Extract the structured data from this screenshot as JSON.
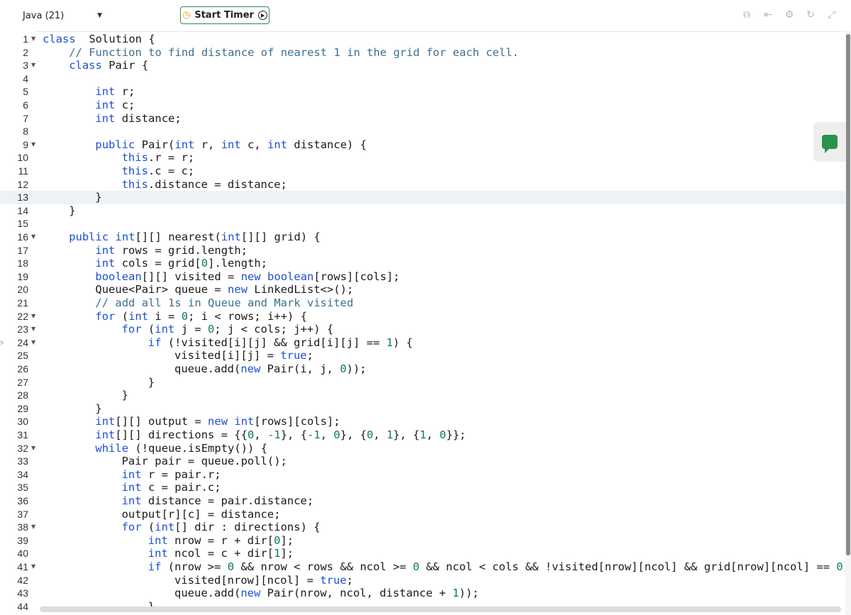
{
  "toolbar": {
    "language": "Java (21)",
    "timer_label": "Start Timer"
  },
  "editor": {
    "current_line": 13,
    "lines": [
      {
        "n": "1",
        "fold": true,
        "indent": 0,
        "segs": [
          [
            "kw",
            "class"
          ],
          [
            "",
            "  Solution {"
          ]
        ]
      },
      {
        "n": "2",
        "fold": false,
        "indent": 4,
        "segs": [
          [
            "cm",
            "// Function to find distance of nearest 1 in the grid for each cell."
          ]
        ]
      },
      {
        "n": "3",
        "fold": true,
        "indent": 4,
        "segs": [
          [
            "kw",
            "class"
          ],
          [
            "",
            " Pair {"
          ]
        ]
      },
      {
        "n": "4",
        "fold": false,
        "indent": 0,
        "segs": []
      },
      {
        "n": "5",
        "fold": false,
        "indent": 8,
        "segs": [
          [
            "kw",
            "int"
          ],
          [
            "",
            " r;"
          ]
        ]
      },
      {
        "n": "6",
        "fold": false,
        "indent": 8,
        "segs": [
          [
            "kw",
            "int"
          ],
          [
            "",
            " c;"
          ]
        ]
      },
      {
        "n": "7",
        "fold": false,
        "indent": 8,
        "segs": [
          [
            "kw",
            "int"
          ],
          [
            "",
            " distance;"
          ]
        ]
      },
      {
        "n": "8",
        "fold": false,
        "indent": 0,
        "segs": []
      },
      {
        "n": "9",
        "fold": true,
        "indent": 8,
        "segs": [
          [
            "kw",
            "public"
          ],
          [
            "",
            " Pair("
          ],
          [
            "kw",
            "int"
          ],
          [
            "",
            " r, "
          ],
          [
            "kw",
            "int"
          ],
          [
            "",
            " c, "
          ],
          [
            "kw",
            "int"
          ],
          [
            "",
            " distance) {"
          ]
        ]
      },
      {
        "n": "10",
        "fold": false,
        "indent": 12,
        "segs": [
          [
            "kw",
            "this"
          ],
          [
            "",
            ".r = r;"
          ]
        ]
      },
      {
        "n": "11",
        "fold": false,
        "indent": 12,
        "segs": [
          [
            "kw",
            "this"
          ],
          [
            "",
            ".c = c;"
          ]
        ]
      },
      {
        "n": "12",
        "fold": false,
        "indent": 12,
        "segs": [
          [
            "kw",
            "this"
          ],
          [
            "",
            ".distance = distance;"
          ]
        ]
      },
      {
        "n": "13",
        "fold": false,
        "indent": 8,
        "segs": [
          [
            "",
            "}"
          ]
        ]
      },
      {
        "n": "14",
        "fold": false,
        "indent": 4,
        "segs": [
          [
            "",
            "}"
          ]
        ]
      },
      {
        "n": "15",
        "fold": false,
        "indent": 0,
        "segs": []
      },
      {
        "n": "16",
        "fold": true,
        "indent": 4,
        "segs": [
          [
            "kw",
            "public"
          ],
          [
            "",
            " "
          ],
          [
            "kw",
            "int"
          ],
          [
            "",
            "[][] nearest("
          ],
          [
            "kw",
            "int"
          ],
          [
            "",
            "[][] grid) {"
          ]
        ]
      },
      {
        "n": "17",
        "fold": false,
        "indent": 8,
        "segs": [
          [
            "kw",
            "int"
          ],
          [
            "",
            " rows = grid.length;"
          ]
        ]
      },
      {
        "n": "18",
        "fold": false,
        "indent": 8,
        "segs": [
          [
            "kw",
            "int"
          ],
          [
            "",
            " cols = grid["
          ],
          [
            "num",
            "0"
          ],
          [
            "",
            "].length;"
          ]
        ]
      },
      {
        "n": "19",
        "fold": false,
        "indent": 8,
        "segs": [
          [
            "kw",
            "boolean"
          ],
          [
            "",
            "[][] visited = "
          ],
          [
            "kw",
            "new"
          ],
          [
            "",
            " "
          ],
          [
            "kw",
            "boolean"
          ],
          [
            "",
            "[rows][cols];"
          ]
        ]
      },
      {
        "n": "20",
        "fold": false,
        "indent": 8,
        "segs": [
          [
            "",
            "Queue<Pair> queue = "
          ],
          [
            "kw",
            "new"
          ],
          [
            "",
            " LinkedList<>();"
          ]
        ]
      },
      {
        "n": "21",
        "fold": false,
        "indent": 8,
        "segs": [
          [
            "cm",
            "// add all 1s in Queue and Mark visited"
          ]
        ]
      },
      {
        "n": "22",
        "fold": true,
        "indent": 8,
        "segs": [
          [
            "kw",
            "for"
          ],
          [
            "",
            " ("
          ],
          [
            "kw",
            "int"
          ],
          [
            "",
            " i = "
          ],
          [
            "num",
            "0"
          ],
          [
            "",
            "; i < rows; i++) {"
          ]
        ]
      },
      {
        "n": "23",
        "fold": true,
        "indent": 12,
        "segs": [
          [
            "kw",
            "for"
          ],
          [
            "",
            " ("
          ],
          [
            "kw",
            "int"
          ],
          [
            "",
            " j = "
          ],
          [
            "num",
            "0"
          ],
          [
            "",
            "; j < cols; j++) {"
          ]
        ]
      },
      {
        "n": "24",
        "fold": true,
        "indent": 16,
        "segs": [
          [
            "kw",
            "if"
          ],
          [
            "",
            " (!visited[i][j] && grid[i][j] == "
          ],
          [
            "num",
            "1"
          ],
          [
            "",
            ") {"
          ]
        ]
      },
      {
        "n": "25",
        "fold": false,
        "indent": 20,
        "segs": [
          [
            "",
            "visited[i][j] = "
          ],
          [
            "lit",
            "true"
          ],
          [
            "",
            ";"
          ]
        ]
      },
      {
        "n": "26",
        "fold": false,
        "indent": 20,
        "segs": [
          [
            "",
            "queue.add("
          ],
          [
            "kw",
            "new"
          ],
          [
            "",
            " Pair(i, j, "
          ],
          [
            "num",
            "0"
          ],
          [
            "",
            "));"
          ]
        ]
      },
      {
        "n": "27",
        "fold": false,
        "indent": 16,
        "segs": [
          [
            "",
            "}"
          ]
        ]
      },
      {
        "n": "28",
        "fold": false,
        "indent": 12,
        "segs": [
          [
            "",
            "}"
          ]
        ]
      },
      {
        "n": "29",
        "fold": false,
        "indent": 8,
        "segs": [
          [
            "",
            "}"
          ]
        ]
      },
      {
        "n": "30",
        "fold": false,
        "indent": 8,
        "segs": [
          [
            "kw",
            "int"
          ],
          [
            "",
            "[][] output = "
          ],
          [
            "kw",
            "new"
          ],
          [
            "",
            " "
          ],
          [
            "kw",
            "int"
          ],
          [
            "",
            "[rows][cols];"
          ]
        ]
      },
      {
        "n": "31",
        "fold": false,
        "indent": 8,
        "segs": [
          [
            "kw",
            "int"
          ],
          [
            "",
            "[][] directions = {{"
          ],
          [
            "num",
            "0"
          ],
          [
            "",
            ", "
          ],
          [
            "num",
            "-1"
          ],
          [
            "",
            "}, {"
          ],
          [
            "num",
            "-1"
          ],
          [
            "",
            ", "
          ],
          [
            "num",
            "0"
          ],
          [
            "",
            "}, {"
          ],
          [
            "num",
            "0"
          ],
          [
            "",
            ", "
          ],
          [
            "num",
            "1"
          ],
          [
            "",
            "}, {"
          ],
          [
            "num",
            "1"
          ],
          [
            "",
            ", "
          ],
          [
            "num",
            "0"
          ],
          [
            "",
            "}};"
          ]
        ]
      },
      {
        "n": "32",
        "fold": true,
        "indent": 8,
        "segs": [
          [
            "kw",
            "while"
          ],
          [
            "",
            " (!queue.isEmpty()) {"
          ]
        ]
      },
      {
        "n": "33",
        "fold": false,
        "indent": 12,
        "segs": [
          [
            "",
            "Pair pair = queue.poll();"
          ]
        ]
      },
      {
        "n": "34",
        "fold": false,
        "indent": 12,
        "segs": [
          [
            "kw",
            "int"
          ],
          [
            "",
            " r = pair.r;"
          ]
        ]
      },
      {
        "n": "35",
        "fold": false,
        "indent": 12,
        "segs": [
          [
            "kw",
            "int"
          ],
          [
            "",
            " c = pair.c;"
          ]
        ]
      },
      {
        "n": "36",
        "fold": false,
        "indent": 12,
        "segs": [
          [
            "kw",
            "int"
          ],
          [
            "",
            " distance = pair.distance;"
          ]
        ]
      },
      {
        "n": "37",
        "fold": false,
        "indent": 12,
        "segs": [
          [
            "",
            "output[r][c] = distance;"
          ]
        ]
      },
      {
        "n": "38",
        "fold": true,
        "indent": 12,
        "segs": [
          [
            "kw",
            "for"
          ],
          [
            "",
            " ("
          ],
          [
            "kw",
            "int"
          ],
          [
            "",
            "[] dir : directions) {"
          ]
        ]
      },
      {
        "n": "39",
        "fold": false,
        "indent": 16,
        "segs": [
          [
            "kw",
            "int"
          ],
          [
            "",
            " nrow = r + dir["
          ],
          [
            "num",
            "0"
          ],
          [
            "",
            "];"
          ]
        ]
      },
      {
        "n": "40",
        "fold": false,
        "indent": 16,
        "segs": [
          [
            "kw",
            "int"
          ],
          [
            "",
            " ncol = c + dir["
          ],
          [
            "num",
            "1"
          ],
          [
            "",
            "];"
          ]
        ]
      },
      {
        "n": "41",
        "fold": true,
        "indent": 16,
        "segs": [
          [
            "kw",
            "if"
          ],
          [
            "",
            " (nrow >= "
          ],
          [
            "num",
            "0"
          ],
          [
            "",
            " && nrow < rows && ncol >= "
          ],
          [
            "num",
            "0"
          ],
          [
            "",
            " && ncol < cols && !visited[nrow][ncol] && grid[nrow][ncol] == "
          ],
          [
            "num",
            "0"
          ],
          [
            "",
            ") {"
          ]
        ]
      },
      {
        "n": "42",
        "fold": false,
        "indent": 20,
        "segs": [
          [
            "",
            "visited[nrow][ncol] = "
          ],
          [
            "lit",
            "true"
          ],
          [
            "",
            ";"
          ]
        ]
      },
      {
        "n": "43",
        "fold": false,
        "indent": 20,
        "segs": [
          [
            "",
            "queue.add("
          ],
          [
            "kw",
            "new"
          ],
          [
            "",
            " Pair(nrow, ncol, distance + "
          ],
          [
            "num",
            "1"
          ],
          [
            "",
            "));"
          ]
        ]
      },
      {
        "n": "44",
        "fold": false,
        "indent": 16,
        "segs": [
          [
            "",
            "}"
          ]
        ]
      }
    ]
  },
  "icons": {
    "tool_icons": [
      "copy-icon",
      "import-icon",
      "settings-icon",
      "reset-icon",
      "fullscreen-icon"
    ],
    "side_button": "chat-icon"
  },
  "colors": {
    "keyword": "#1f4fd1",
    "comment": "#3c6f8f",
    "number": "#0e7a5f",
    "timer_border": "#2e8b57",
    "chat_green": "#2b9348"
  }
}
